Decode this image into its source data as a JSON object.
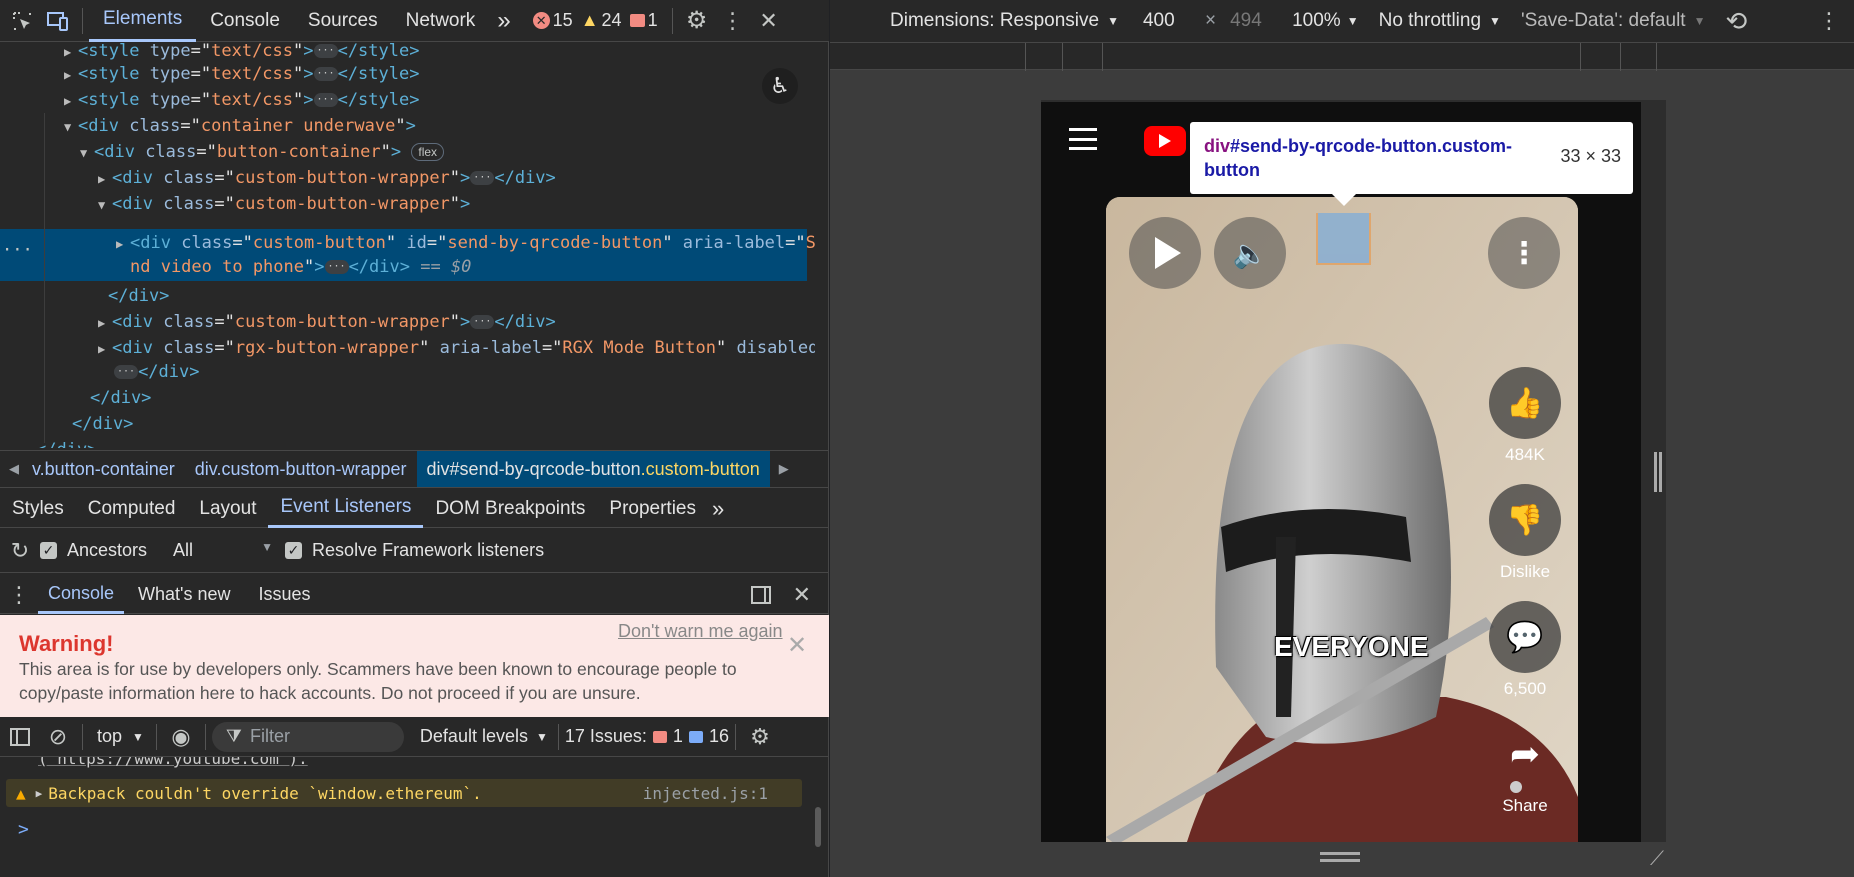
{
  "devtools": {
    "tabs": [
      "Elements",
      "Console",
      "Sources",
      "Network"
    ],
    "more_tabs": "»",
    "errors": "15",
    "warnings": "24",
    "issues": "1"
  },
  "dom": {
    "style_tag": "style",
    "style_attr": "type",
    "style_val": "text/css",
    "style_close": "</style>",
    "container_class": "container underwave",
    "button_container_class": "button-container",
    "flex_pill": "flex",
    "wrapper_class": "custom-button-wrapper",
    "sel_class": "custom-button",
    "sel_id": "send-by-qrcode-button",
    "sel_aria_part1": "Se",
    "sel_aria_part2": "nd video to phone",
    "sel_suffix": "== $0",
    "rgx_class": "rgx-button-wrapper",
    "rgx_aria": "RGX Mode Button",
    "rgx_disabled": "disabled",
    "close_div": "</div>",
    "ellipsis": "···"
  },
  "breadcrumb": {
    "items": [
      "v.button-container",
      "div.custom-button-wrapper"
    ],
    "active_tag": "div",
    "active_id": "#send-by-qrcode-button",
    "active_class": ".custom-button"
  },
  "subtabs": [
    "Styles",
    "Computed",
    "Layout",
    "Event Listeners",
    "DOM Breakpoints",
    "Properties"
  ],
  "listeners": {
    "ancestors": "Ancestors",
    "all": "All",
    "resolve": "Resolve Framework listeners"
  },
  "drawer": {
    "tabs": [
      "Console",
      "What's new",
      "Issues"
    ]
  },
  "warning": {
    "title": "Warning!",
    "dont_warn": "Don't warn me again",
    "body1": "This area is for use by developers only. Scammers have been known to encourage people to",
    "body2": "copy/paste information here to hack accounts. Do not proceed if you are unsure."
  },
  "console": {
    "context": "top",
    "filter_placeholder": "Filter",
    "levels": "Default levels",
    "issues_label": "17 Issues:",
    "issues_err": "1",
    "issues_info": "16",
    "url_line": "( https://www.youtube.com ).",
    "warn_msg": "Backpack couldn't override `window.ethereum`.",
    "warn_src": "injected.js:1",
    "prompt": ">"
  },
  "device": {
    "dimensions": "Dimensions: Responsive",
    "width": "400",
    "x": "×",
    "height": "494",
    "zoom": "100%",
    "throttle": "No throttling",
    "savedata": "'Save-Data': default"
  },
  "tooltip": {
    "tag": "div",
    "selector": "#send-by-qrcode-button.custom-",
    "selector2": "button",
    "size": "33 × 33"
  },
  "video": {
    "caption": "EVERYONE",
    "likes": "484K",
    "dislike": "Dislike",
    "comments": "6,500",
    "share": "Share"
  },
  "colors": {
    "accent": "#a8c7fa",
    "selection": "#004a77",
    "error": "#f28b82",
    "warning_bg": "#fce8e6",
    "youtube_red": "#ff0000"
  }
}
